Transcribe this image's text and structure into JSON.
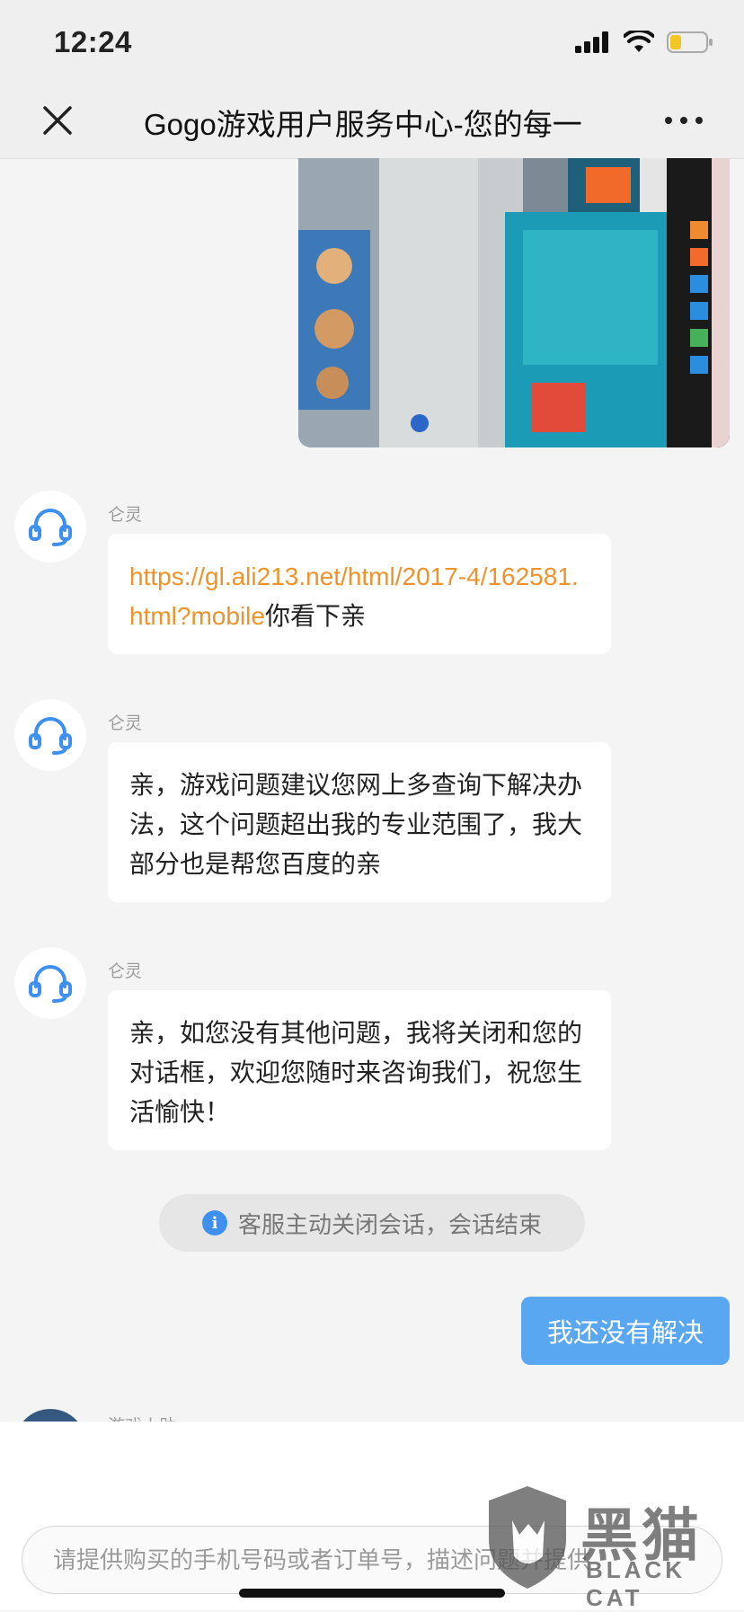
{
  "status_bar": {
    "time": "12:24"
  },
  "nav": {
    "title": "Gogo游戏用户服务中心-您的每一"
  },
  "messages": [
    {
      "sender": "仑灵",
      "link": "https://gl.ali213.net/html/2017-4/162581.html?mobile",
      "text": "你看下亲"
    },
    {
      "sender": "仑灵",
      "text": "亲，游戏问题建议您网上多查询下解决办法，这个问题超出我的专业范围了，我大部分也是帮您百度的亲"
    },
    {
      "sender": "仑灵",
      "text": "亲，如您没有其他问题，我将关闭和您的对话框，欢迎您随时来咨询我们，祝您生活愉快！"
    }
  ],
  "notice": {
    "text": "客服主动关闭会话，会话结束"
  },
  "user_message": {
    "text": "我还没有解决"
  },
  "partial_sender": "游戏小助",
  "input": {
    "placeholder": "请提供购买的手机号码或者订单号，描述问题并提供"
  },
  "watermark": {
    "big": "黑猫",
    "small": "BLACK CAT"
  },
  "colors": {
    "link": "#f0922a",
    "user_bubble": "#5aa7f1",
    "info": "#3d8ff0"
  }
}
